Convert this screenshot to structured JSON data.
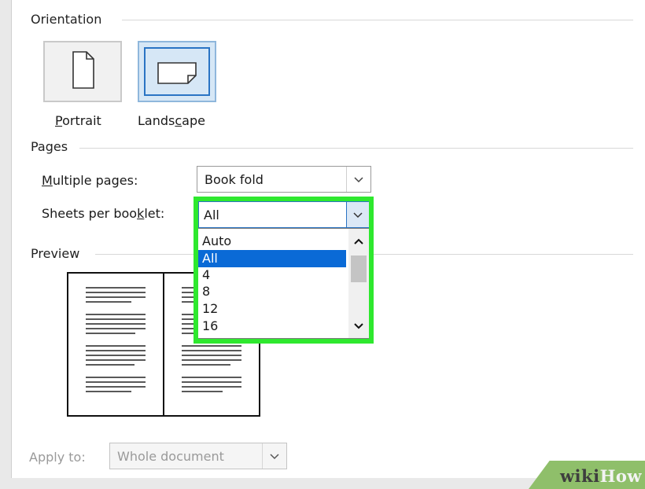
{
  "orientation": {
    "section_title": "Orientation",
    "portrait_label": "Portrait",
    "landscape_label": "Landscape",
    "selected": "Landscape"
  },
  "pages": {
    "section_title": "Pages",
    "multiple_pages_label": "Multiple pages:",
    "multiple_pages_value": "Book fold",
    "sheets_label": "Sheets per booklet:",
    "sheets_value": "All",
    "sheets_options": [
      "Auto",
      "All",
      "4",
      "8",
      "12",
      "16"
    ],
    "sheets_selected_index": 1
  },
  "preview": {
    "section_title": "Preview"
  },
  "apply_to": {
    "label": "Apply to:",
    "value": "Whole document"
  },
  "watermark": {
    "wiki": "wiki",
    "how": "How"
  },
  "colors": {
    "highlight": "#2ee82e",
    "selection": "#0a6ad6",
    "accent_border": "#2a74c4"
  },
  "icons": [
    "portrait-page-icon",
    "landscape-page-icon",
    "chevron-down-icon",
    "chevron-up-icon"
  ]
}
